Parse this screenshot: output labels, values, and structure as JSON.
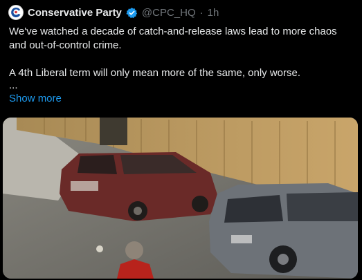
{
  "tweet": {
    "author_name": "Conservative Party",
    "handle": "@CPC_HQ",
    "separator": "·",
    "time": "1h",
    "paragraph1": "We've watched a decade of catch-and-release laws lead to more chaos and out-of-control crime.",
    "paragraph2": "A 4th Liberal term will only mean more of the same, only worse.",
    "ellipsis": "...",
    "show_more": "Show more",
    "avatar_icon": "conservative-party-logo-icon",
    "verified_icon": "verified-badge-icon",
    "media_description_icon": "video-still"
  },
  "colors": {
    "background": "#000000",
    "text": "#e7e9ea",
    "muted": "#71767b",
    "link": "#1d9bf0",
    "verified": "#1d9bf0",
    "brand_red": "#d32027"
  }
}
